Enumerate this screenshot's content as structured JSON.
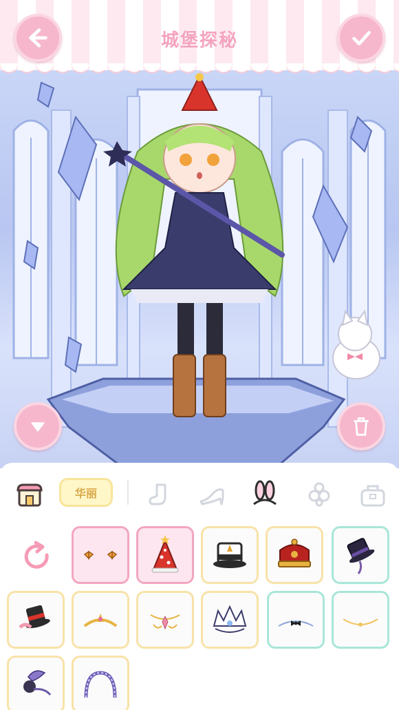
{
  "header": {
    "title": "城堡探秘",
    "back_icon": "arrow-left-icon",
    "confirm_icon": "checkmark-icon"
  },
  "scene": {
    "collapse_icon": "triangle-down-icon",
    "delete_icon": "trash-icon"
  },
  "tabs": [
    {
      "name": "shop",
      "icon": "shop-icon"
    },
    {
      "name": "category",
      "label": "华丽"
    },
    {
      "name": "socks",
      "icon": "sock-icon"
    },
    {
      "name": "shoes",
      "icon": "high-heel-icon"
    },
    {
      "name": "headwear",
      "icon": "bunny-ears-icon",
      "active": true
    },
    {
      "name": "accessories",
      "icon": "flower-icon"
    },
    {
      "name": "bags",
      "icon": "bag-icon"
    }
  ],
  "items": [
    {
      "name": "bow-clips",
      "selected": false
    },
    {
      "name": "party-hat",
      "selected": true
    },
    {
      "name": "top-hat-gold",
      "selected": false
    },
    {
      "name": "royal-crown",
      "selected": false
    },
    {
      "name": "mini-top-hat-purple",
      "selected": false
    },
    {
      "name": "mini-top-hat-red",
      "selected": false
    },
    {
      "name": "tiara-gold",
      "selected": false
    },
    {
      "name": "jewel-circlet",
      "selected": false
    },
    {
      "name": "crystal-crown",
      "selected": false
    },
    {
      "name": "black-bow-band",
      "selected": false
    },
    {
      "name": "gold-chain-circlet",
      "selected": false
    },
    {
      "name": "feather-hairpiece",
      "selected": false
    },
    {
      "name": "lace-headband",
      "selected": false
    }
  ],
  "colors": {
    "accent_pink": "#f6b7cc",
    "title_pink": "#f4a3bf",
    "cell_gold_border": "#f8e2a8",
    "cell_teal_border": "#a8e6d8",
    "cell_selected_bg": "#fde6ef"
  }
}
